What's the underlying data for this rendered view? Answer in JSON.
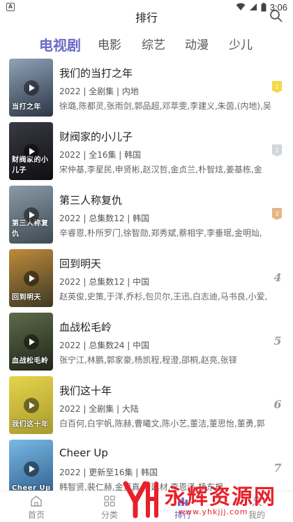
{
  "status_bar": {
    "time": "3:06"
  },
  "header": {
    "title": "排行"
  },
  "tabs": [
    {
      "label": "电视剧",
      "active": true
    },
    {
      "label": "电影",
      "active": false
    },
    {
      "label": "综艺",
      "active": false
    },
    {
      "label": "动漫",
      "active": false
    },
    {
      "label": "少儿",
      "active": false
    }
  ],
  "items": [
    {
      "title": "我们的当打之年",
      "meta": "2022 | 全剧集 | 内地",
      "cast": "徐璐,陈都灵,张雨剑,郭品超,邓萃雯,李建义,朱茵,(内地),吴",
      "rank": "1",
      "poster_text": "当打之年",
      "poster_colors": [
        "#8fa3b8",
        "#2c3645"
      ]
    },
    {
      "title": "财阀家的小儿子",
      "meta": "2022 | 全16集 | 韩国",
      "cast": "宋仲基,李星民,申贤彬,赵汉哲,金贞兰,朴智炫,姜基栋,金",
      "rank": "2",
      "poster_text": "财阀家的小儿子",
      "poster_colors": [
        "#3a3a44",
        "#0e0e12"
      ]
    },
    {
      "title": "第三人称复仇",
      "meta": "2022 | 总集数12 | 韩国",
      "cast": "辛睿恩,朴所罗门,徐智勋,郑秀斌,蔡相宇,李垂珉,金明灿,",
      "rank": "3",
      "poster_text": "第三人称复仇",
      "poster_colors": [
        "#8a9aa8",
        "#3e4a52"
      ]
    },
    {
      "title": "回到明天",
      "meta": "2022 | 总集数12 | 中国",
      "cast": "赵英俊,史策,于洋,乔杉,包贝尔,王迅,白志迪,马书良,小爱,",
      "rank": "4",
      "poster_text": "回到明天",
      "poster_colors": [
        "#c08a3a",
        "#3d3a24"
      ]
    },
    {
      "title": "血战松毛岭",
      "meta": "2022 | 总集数24 | 中国",
      "cast": "张宁江,林鹏,郭家豪,杨凯程,程澄,邵桐,赵亮,张铎",
      "rank": "5",
      "poster_text": "血战松毛岭",
      "poster_colors": [
        "#5e6a4a",
        "#20261a"
      ]
    },
    {
      "title": "我们这十年",
      "meta": "2022 | 全剧集 | 大陆",
      "cast": "白百何,白宇帆,陈赫,曹曦文,陈小艺,董洁,董思怡,董勇,郭",
      "rank": "6",
      "poster_text": "我们这十年",
      "poster_colors": [
        "#e6d44a",
        "#a89a2e"
      ]
    },
    {
      "title": "Cheer Up",
      "meta": "2022 | 更新至16集 | 韩国",
      "cast": "韩智贤,裴仁赫,金贤真,李廷材,李恩泽,杨东根",
      "rank": "7",
      "poster_text": "Cheer Up",
      "poster_colors": [
        "#79b8e6",
        "#2e5e8a"
      ]
    }
  ],
  "bottom_nav": [
    {
      "label": "首页",
      "icon": "home-icon",
      "active": false
    },
    {
      "label": "分类",
      "icon": "category-icon",
      "active": false
    },
    {
      "label": "排行",
      "icon": "rank-icon",
      "active": true
    },
    {
      "label": "我的",
      "icon": "profile-icon",
      "active": false
    }
  ],
  "watermark": {
    "text": "永辉资源网",
    "url": "www.yhkjjj.com"
  },
  "colors": {
    "accent": "#6a68c8",
    "badge_1": "#f3d84a",
    "badge_2": "#d2d6da",
    "badge_3": "#e6b783"
  }
}
